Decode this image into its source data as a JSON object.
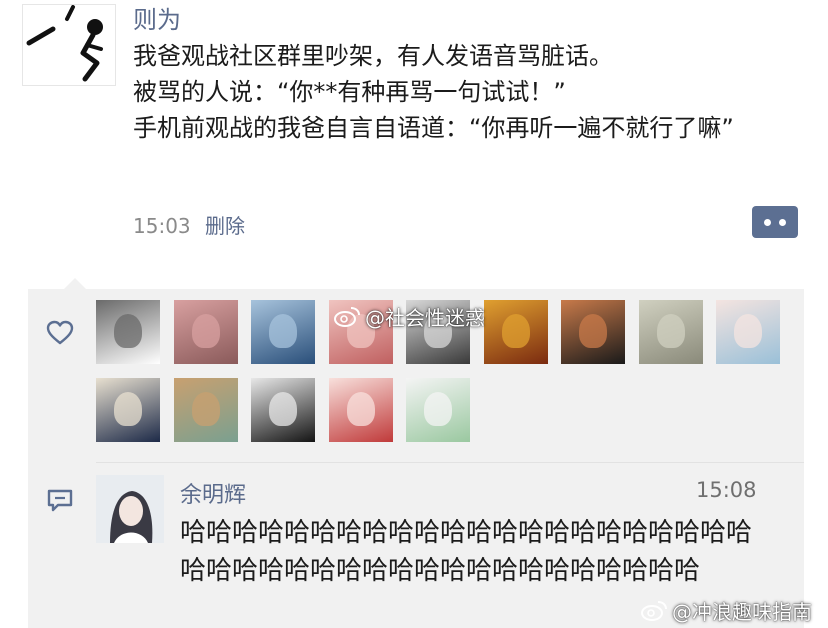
{
  "post": {
    "author": "则为",
    "lines": [
      "我爸观战社区群里吵架，有人发语音骂脏话。",
      "被骂的人说：“你**有种再骂一句试试！”",
      "手机前观战的我爸自言自语道：“你再听一遍不就行了嘛”"
    ],
    "time": "15:03",
    "delete_label": "删除"
  },
  "likes": {
    "icon": "heart-outline-icon",
    "avatars": [
      {
        "name": "avatar-sketch-cartoon",
        "colors": [
          "#ffffff",
          "#6a6a6a"
        ]
      },
      {
        "name": "avatar-pink-portrait",
        "colors": [
          "#8a5a5a",
          "#d8a0a0"
        ]
      },
      {
        "name": "avatar-mountain-lake",
        "colors": [
          "#2a4f7a",
          "#a7c3dc"
        ]
      },
      {
        "name": "avatar-anime-girl-pink",
        "colors": [
          "#c06060",
          "#f0c4c0"
        ]
      },
      {
        "name": "avatar-bw-photo",
        "colors": [
          "#3a3a3a",
          "#d8d8d8"
        ]
      },
      {
        "name": "avatar-autumn-leaves",
        "colors": [
          "#7a2a10",
          "#e0a030"
        ]
      },
      {
        "name": "avatar-sunglasses-man",
        "colors": [
          "#1a1a1a",
          "#c87a4a"
        ]
      },
      {
        "name": "avatar-cat",
        "colors": [
          "#8a8a7a",
          "#d0d0c0"
        ]
      },
      {
        "name": "avatar-anime-girl-blue-hair",
        "colors": [
          "#9ac0d8",
          "#f4e4e0"
        ]
      },
      {
        "name": "avatar-penguin-cartoon",
        "colors": [
          "#1d2a48",
          "#e8e0d0"
        ]
      },
      {
        "name": "avatar-cartoon-animal",
        "colors": [
          "#7aa090",
          "#c8a070"
        ]
      },
      {
        "name": "avatar-black-logo",
        "colors": [
          "#141414",
          "#e8e8e8"
        ]
      },
      {
        "name": "avatar-anime-girl-red-hair",
        "colors": [
          "#c03a3a",
          "#f8e0dc"
        ]
      },
      {
        "name": "avatar-anime-girl-green",
        "colors": [
          "#9ac8a0",
          "#f4f4f4"
        ]
      }
    ]
  },
  "comment": {
    "icon": "comment-bubble-icon",
    "author": "余明辉",
    "time": "15:08",
    "text": "哈哈哈哈哈哈哈哈哈哈哈哈哈哈哈哈哈哈哈哈哈哈哈哈哈哈哈哈哈哈哈哈哈哈哈哈哈哈哈哈哈哈"
  },
  "watermarks": {
    "center": "@社会性迷惑",
    "bottom_right": "@冲浪趣味指南"
  },
  "colors": {
    "name_link": "#5b6b8c",
    "panel_bg": "#f1f1f1",
    "more_button": "#5c6f92"
  }
}
